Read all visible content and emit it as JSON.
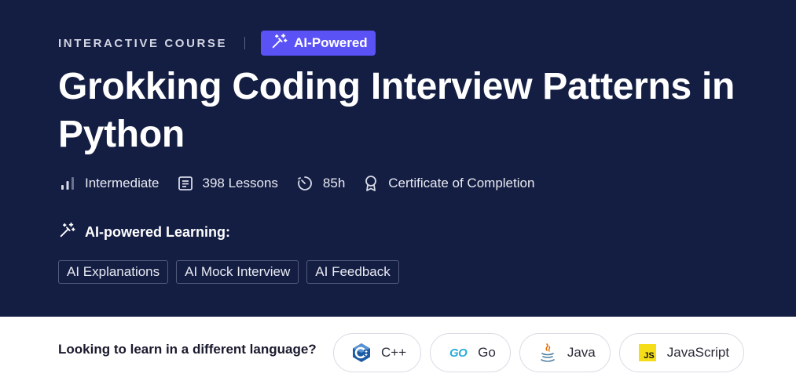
{
  "hero": {
    "eyebrow": "INTERACTIVE COURSE",
    "badge": "AI-Powered",
    "title": "Grokking Coding Interview Patterns in Python",
    "meta": {
      "level": "Intermediate",
      "lessons": "398 Lessons",
      "duration": "85h",
      "certificate": "Certificate of Completion"
    },
    "ai_learning_label": "AI-powered Learning:",
    "ai_features": [
      "AI Explanations",
      "AI Mock Interview",
      "AI Feedback"
    ]
  },
  "languages": {
    "question": "Looking to learn in a different language?",
    "options": [
      {
        "label": "C++",
        "icon": "cpp-icon"
      },
      {
        "label": "Go",
        "icon": "go-icon",
        "icon_text": "GO"
      },
      {
        "label": "Java",
        "icon": "java-icon"
      },
      {
        "label": "JavaScript",
        "icon": "javascript-icon",
        "icon_text": "JS"
      }
    ]
  },
  "colors": {
    "hero_bg": "#141e43",
    "badge_bg": "#5b52f6",
    "js_yellow": "#f5de19"
  }
}
